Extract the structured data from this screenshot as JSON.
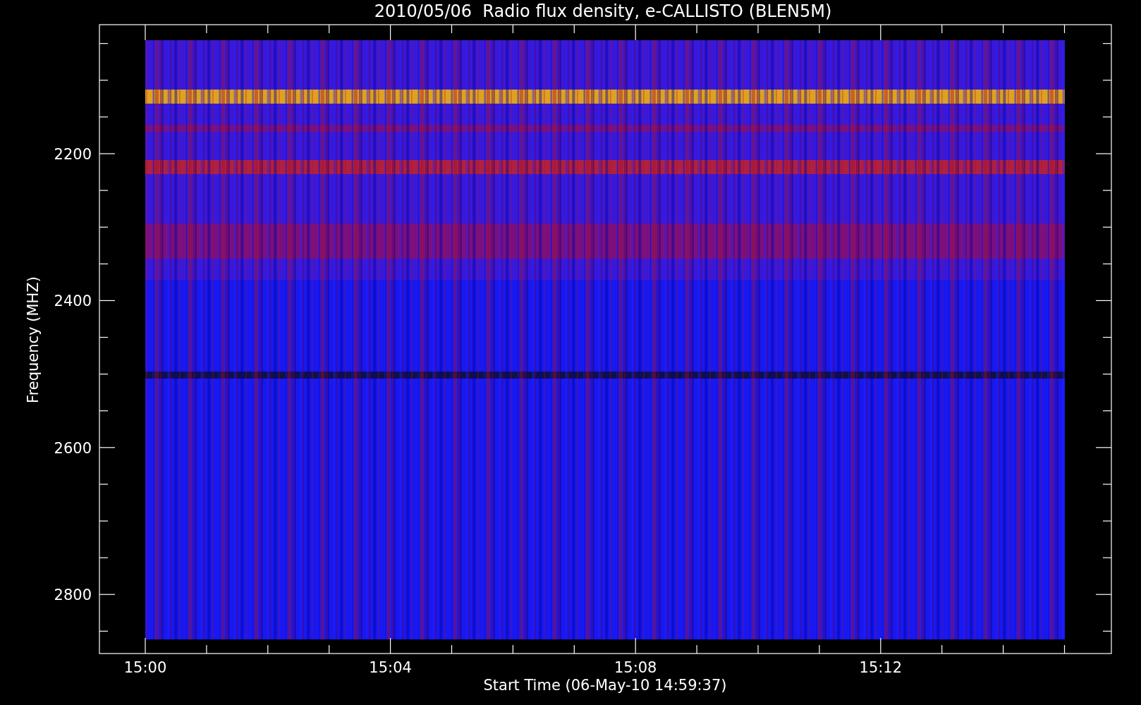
{
  "title": "2010/05/06  Radio flux density, e-CALLISTO (BLEN5M)",
  "y_axis": {
    "label": "Frequency (MHZ)",
    "tick_labels": [
      "2200",
      "2400",
      "2600",
      "2800"
    ]
  },
  "x_axis": {
    "label": "Start Time (06-May-10 14:59:37)",
    "tick_labels": [
      "15:00",
      "15:04",
      "15:08",
      "15:12"
    ]
  }
}
